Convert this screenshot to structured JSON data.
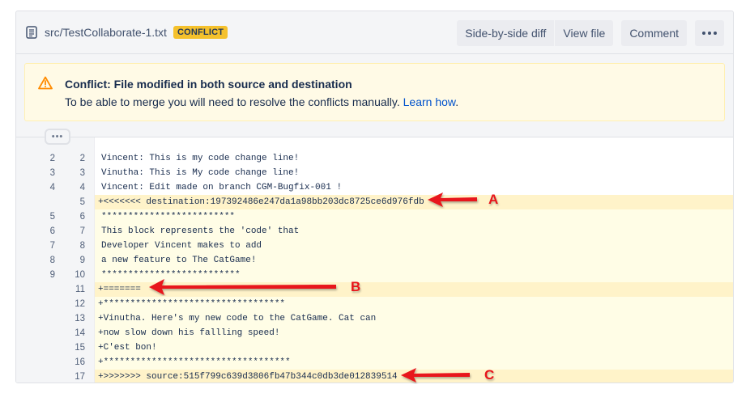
{
  "file": {
    "icon": "file-text-icon",
    "path": "src/TestCollaborate-1.txt",
    "badge": "CONFLICT"
  },
  "actions": {
    "side_by_side": "Side-by-side diff",
    "view_file": "View file",
    "comment": "Comment",
    "more": "more-options-icon"
  },
  "banner": {
    "icon": "warning-icon",
    "title": "Conflict: File modified in both source and destination",
    "text": "To be able to merge you will need to resolve the conflicts manually.",
    "link": "Learn how",
    "after_link": "."
  },
  "expand": {
    "label": "•••",
    "icon": "expand-context-icon"
  },
  "colors": {
    "badge": "#f5c12c",
    "banner_bg": "#fffae6",
    "link": "#0052cc",
    "added_bg": "#fffde6",
    "marker_bg": "#fff3c9",
    "annotation": "#e8141a"
  },
  "lines": [
    {
      "old": "2",
      "new": "2",
      "type": "ctx",
      "text": "Vincent: This is my code change line!"
    },
    {
      "old": "3",
      "new": "3",
      "type": "ctx",
      "text": "Vinutha: This is My code change line!"
    },
    {
      "old": "4",
      "new": "4",
      "type": "ctx",
      "text": "Vincent: Edit made on branch CGM-Bugfix-001 !"
    },
    {
      "old": "",
      "new": "5",
      "type": "marker",
      "text": "+<<<<<<< destination:197392486e247da1a98bb203dc8725ce6d976fdb"
    },
    {
      "old": "5",
      "new": "6",
      "type": "changed",
      "text": "*************************"
    },
    {
      "old": "6",
      "new": "7",
      "type": "changed",
      "text": "This block represents the 'code' that"
    },
    {
      "old": "7",
      "new": "8",
      "type": "changed",
      "text": "Developer Vincent makes to add"
    },
    {
      "old": "8",
      "new": "9",
      "type": "changed",
      "text": "a new feature to The CatGame!"
    },
    {
      "old": "9",
      "new": "10",
      "type": "changed",
      "text": "**************************"
    },
    {
      "old": "",
      "new": "11",
      "type": "marker",
      "text": "+======="
    },
    {
      "old": "",
      "new": "12",
      "type": "added",
      "text": "+**********************************"
    },
    {
      "old": "",
      "new": "13",
      "type": "added",
      "text": "+Vinutha. Here's my new code to the CatGame. Cat can"
    },
    {
      "old": "",
      "new": "14",
      "type": "added",
      "text": "+now slow down his fallling speed!"
    },
    {
      "old": "",
      "new": "15",
      "type": "added",
      "text": "+C'est bon!"
    },
    {
      "old": "",
      "new": "16",
      "type": "added",
      "text": "+***********************************"
    },
    {
      "old": "",
      "new": "17",
      "type": "marker",
      "text": "+>>>>>>> source:515f799c639d3806fb47b344c0db3de012839514"
    }
  ],
  "annotations": [
    {
      "label": "A",
      "icon": "arrow-left-icon"
    },
    {
      "label": "B",
      "icon": "arrow-left-icon"
    },
    {
      "label": "C",
      "icon": "arrow-left-icon"
    }
  ]
}
